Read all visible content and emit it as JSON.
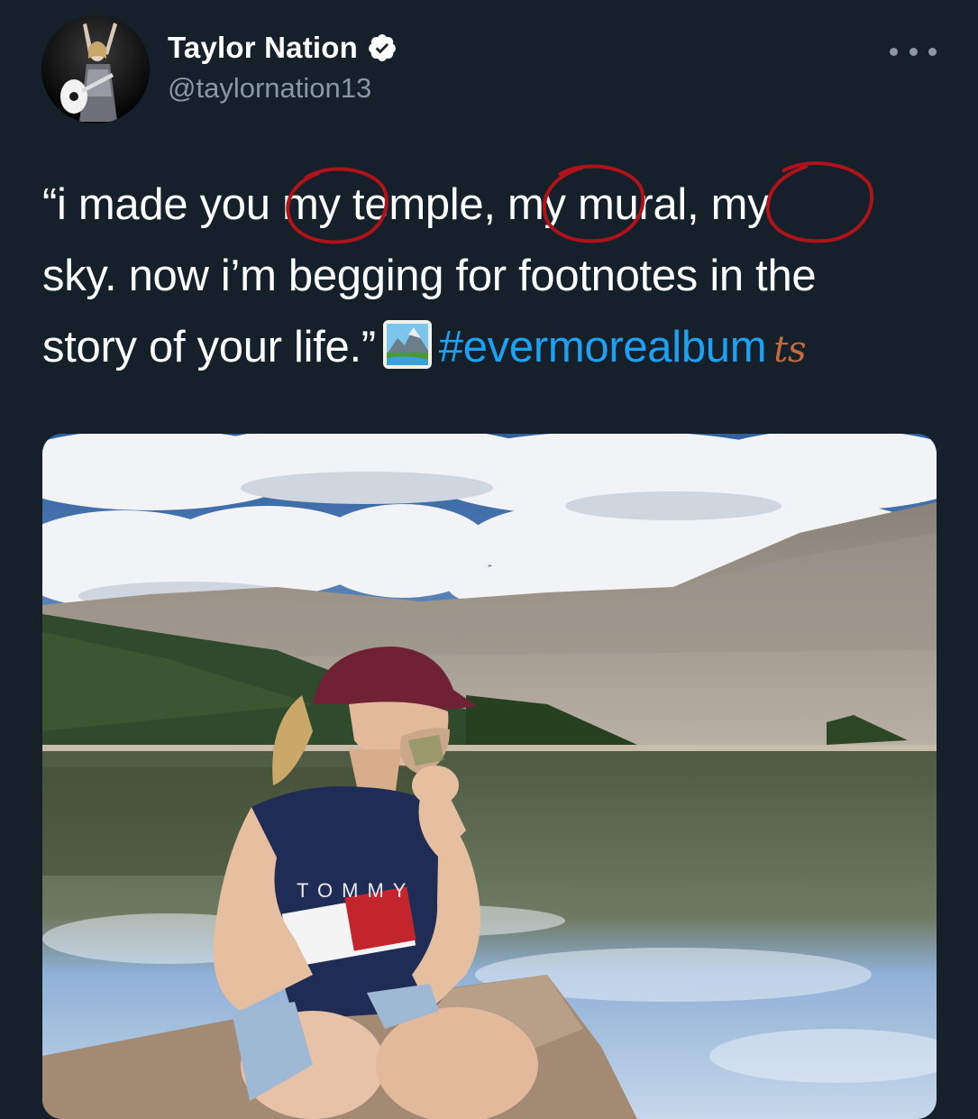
{
  "tweet": {
    "author": {
      "display_name": "Taylor Nation",
      "handle": "@taylornation13",
      "verified": true
    },
    "text_lines": [
      "“i made you my temple, my mural, my",
      "sky. now i’m begging for footnotes in the",
      "story of your life.”"
    ],
    "emoji": "picture-emoji",
    "hashtag": "#evermorealbum",
    "annotation": "ts",
    "media": {
      "shirt_text": "TOMMY"
    }
  },
  "colors": {
    "background": "#15202b",
    "handle_gray": "#8899a6",
    "hashtag_blue": "#1da1f2",
    "annotation_red": "#b0121b",
    "ts_brown": "#c46a3c"
  },
  "icons": {
    "verified": "verified-badge-icon",
    "more": "more-options-icon"
  }
}
